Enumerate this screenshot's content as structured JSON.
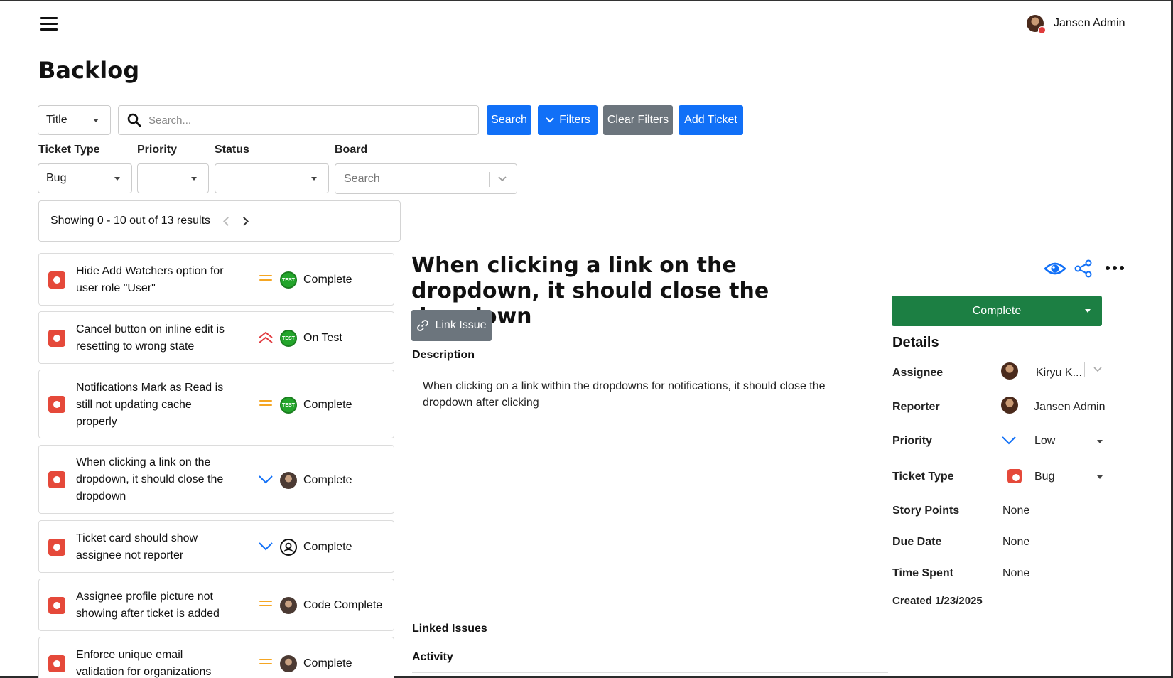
{
  "header": {
    "user_name": "Jansen Admin"
  },
  "page": {
    "title": "Backlog"
  },
  "toolbar": {
    "search_field": "Title",
    "search_placeholder": "Search...",
    "search_button": "Search",
    "filters_button": "Filters",
    "clear_filters_button": "Clear Filters",
    "add_ticket_button": "Add Ticket"
  },
  "filters": {
    "ticket_type_label": "Ticket Type",
    "ticket_type_value": "Bug",
    "priority_label": "Priority",
    "priority_value": "",
    "status_label": "Status",
    "status_value": "",
    "board_label": "Board",
    "board_placeholder": "Search"
  },
  "results": {
    "text": "Showing 0 - 10 out of 13 results"
  },
  "tickets": [
    {
      "title": "Hide Add Watchers option for user role \"User\"",
      "priority": "medium",
      "status": "Complete",
      "status_icon": "test-badge-icon"
    },
    {
      "title": "Cancel button on inline edit is resetting to wrong state",
      "priority": "highest",
      "status": "On Test",
      "status_icon": "test-badge-icon"
    },
    {
      "title": "Notifications Mark as Read is still not updating cache properly",
      "priority": "medium",
      "status": "Complete",
      "status_icon": "test-badge-icon"
    },
    {
      "title": "When clicking a link on the dropdown, it should close the dropdown",
      "priority": "low",
      "status": "Complete",
      "status_icon": "assignee-avatar"
    },
    {
      "title": "Ticket card should show assignee not reporter",
      "priority": "low",
      "status": "Complete",
      "status_icon": "user-outline-icon"
    },
    {
      "title": "Assignee profile picture not showing after ticket is added",
      "priority": "medium",
      "status": "Code Complete",
      "status_icon": "assignee-avatar"
    },
    {
      "title": "Enforce unique email validation for organizations",
      "priority": "medium",
      "status": "Complete",
      "status_icon": "assignee-avatar"
    }
  ],
  "detail": {
    "title": "When clicking a link on the dropdown, it should close the dropdown",
    "link_issue": "Link Issue",
    "description_label": "Description",
    "description": "When clicking on a link within the dropdowns for notifications, it should close the dropdown after clicking",
    "linked_issues_label": "Linked Issues",
    "activity_label": "Activity",
    "status": "Complete",
    "details_label": "Details",
    "assignee_label": "Assignee",
    "assignee": "Kiryu K...",
    "reporter_label": "Reporter",
    "reporter": "Jansen Admin",
    "priority_label": "Priority",
    "priority": "Low",
    "ticket_type_label": "Ticket Type",
    "ticket_type": "Bug",
    "story_points_label": "Story Points",
    "story_points": "None",
    "due_date_label": "Due Date",
    "due_date": "None",
    "time_spent_label": "Time Spent",
    "time_spent": "None",
    "created": "Created 1/23/2025"
  },
  "colors": {
    "primary": "#1170f7",
    "secondary": "#6c757d",
    "success": "#1c7f43",
    "bug": "#e5493a",
    "priority_medium": "#f5a623",
    "priority_high": "#e0393e",
    "priority_low": "#1170f7"
  }
}
